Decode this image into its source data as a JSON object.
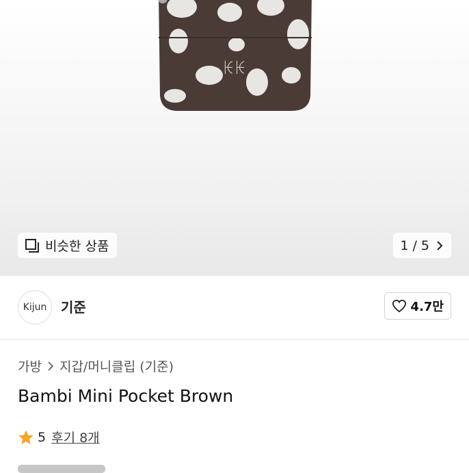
{
  "hero": {
    "similar_label": "비슷한 상품",
    "counter": "1 / 5"
  },
  "seller": {
    "avatar_text": "Kijun",
    "name": "기준",
    "likes": "4.7만"
  },
  "breadcrumb": {
    "level1": "가방",
    "level2": "지갑/머니클립 (기준)"
  },
  "product": {
    "title": "Bambi Mini Pocket Brown",
    "rating": "5",
    "reviews": "후기 8개"
  },
  "colors": {
    "star": "#f5a623",
    "bag_fur": "#4a3b36",
    "spots": "#e8e6e3"
  }
}
